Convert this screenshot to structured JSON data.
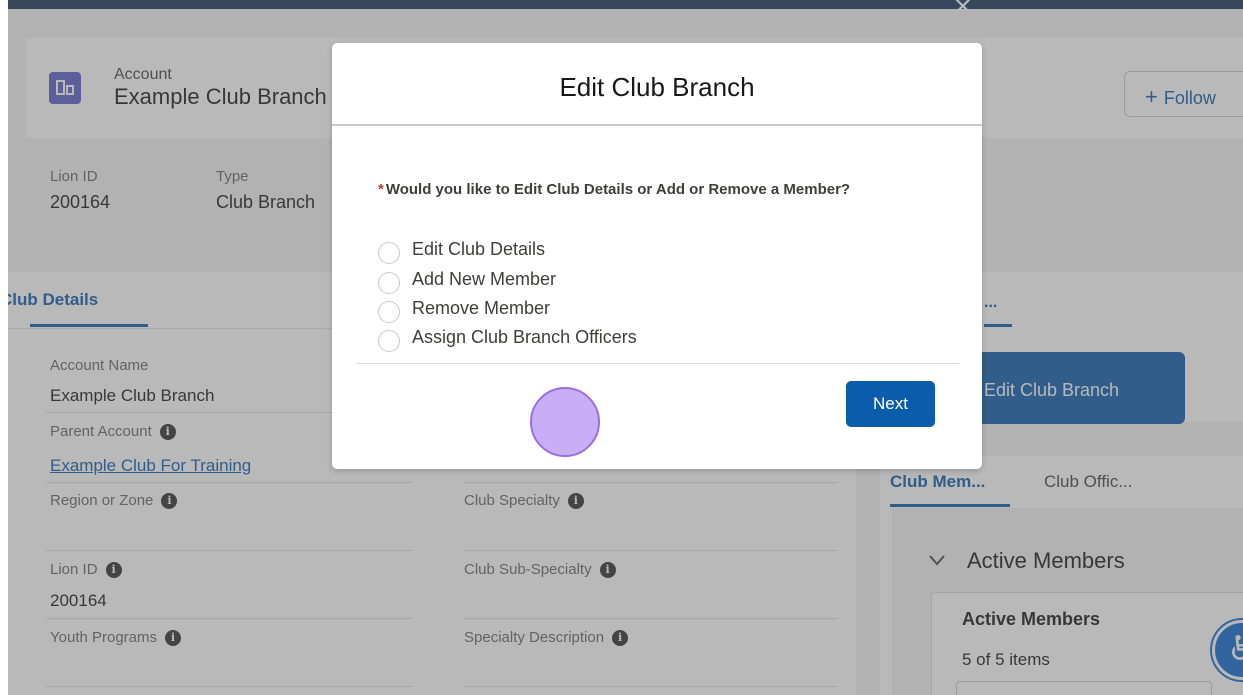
{
  "header": {
    "object_type": "Account",
    "record_name": "Example Club Branch",
    "follow_label": "Follow",
    "highlights": [
      {
        "label": "Lion ID",
        "value": "200164"
      },
      {
        "label": "Type",
        "value": "Club Branch"
      }
    ]
  },
  "details": {
    "tab_label": "Club Details",
    "account_name_label": "Account Name",
    "account_name_value": "Example Club Branch",
    "parent_account_label": "Parent Account",
    "parent_account_value": "Example Club For Training",
    "region_label": "Region or Zone",
    "club_specialty_label": "Club Specialty",
    "lion_id_label": "Lion ID",
    "lion_id_value": "200164",
    "club_sub_specialty_label": "Club Sub-Specialty",
    "youth_programs_label": "Youth Programs",
    "specialty_description_label": "Specialty Description"
  },
  "right_panel": {
    "tab_label": "...",
    "edit_branch_button": "Edit Club Branch",
    "tabs": [
      "Club Mem...",
      "Club Offic..."
    ],
    "section_title": "Active Members",
    "card_title": "Active Members",
    "card_count": "5 of 5 items"
  },
  "modal": {
    "title": "Edit Club Branch",
    "required_marker": "*",
    "question": "Would you like to Edit Club Details or Add or Remove a Member?",
    "options": [
      "Edit Club Details",
      "Add New Member",
      "Remove Member",
      "Assign Club Branch Officers"
    ],
    "next_label": "Next"
  },
  "icons": {
    "topbar_close": "×",
    "follow_plus": "+",
    "info": "i",
    "chevron": "⌄",
    "accessibility": "♿"
  },
  "colors": {
    "brand": "#0b5cab",
    "nav_bar": "#16325c",
    "account_icon": "#5a5fc8",
    "required": "#c23934",
    "click_marker": "#b9a0f5"
  }
}
